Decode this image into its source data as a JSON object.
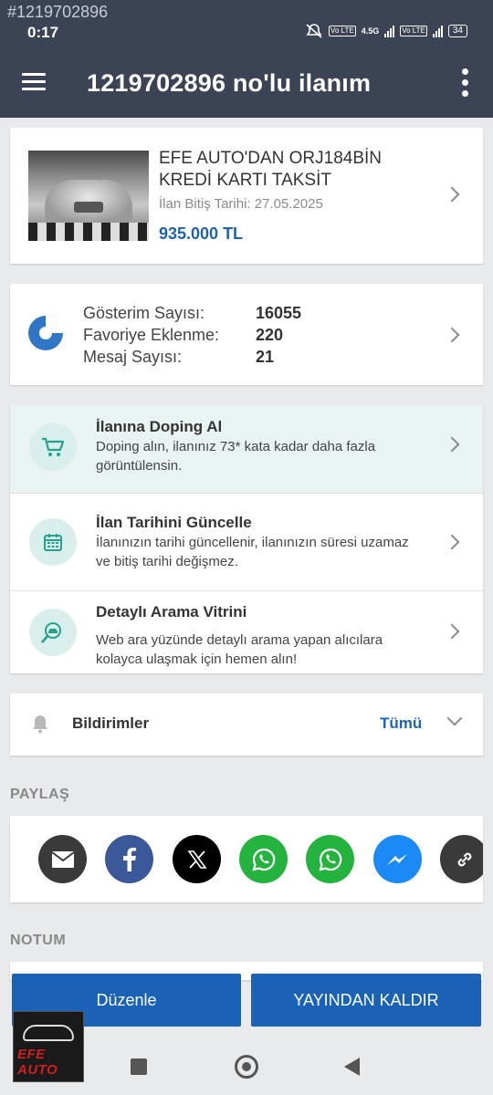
{
  "status": {
    "watermark": "#1219702896",
    "time": "0:17",
    "net_label": "4.5G",
    "lte_label": "Vo LTE",
    "battery": "34"
  },
  "appbar": {
    "title": "1219702896 no'lu ilanım"
  },
  "listing": {
    "title": "EFE AUTO'DAN ORJ184BİN KREDİ KARTI TAKSİT",
    "end_date": "İlan Bitiş Tarihi: 27.05.2025",
    "price": "935.000 TL"
  },
  "stats": [
    {
      "label": "Gösterim Sayısı:",
      "value": "16055"
    },
    {
      "label": "Favoriye Eklenme:",
      "value": "220"
    },
    {
      "label": "Mesaj Sayısı:",
      "value": "21"
    }
  ],
  "promos": [
    {
      "title": "İlanına Doping Al",
      "desc": "Doping alın, ilanınız 73* kata kadar daha fazla görüntülensin.",
      "icon": "cart-icon"
    },
    {
      "title": "İlan Tarihini Güncelle",
      "desc": "İlanınızın tarihi güncellenir, ilanınızın süresi uzamaz ve bitiş tarihi değişmez.",
      "icon": "calendar-icon"
    },
    {
      "title": "Detaylı Arama Vitrini",
      "desc": "Web ara yüzünde detaylı arama yapan alıcılara kolayca ulaşmak için hemen alın!",
      "icon": "search-car-icon"
    }
  ],
  "notifications": {
    "title": "Bildirimler",
    "all_label": "Tümü"
  },
  "share": {
    "label": "PAYLAŞ",
    "buttons": [
      {
        "name": "email-icon",
        "color": "#3a3a3a"
      },
      {
        "name": "facebook-icon",
        "color": "#3b5998"
      },
      {
        "name": "x-icon",
        "color": "#000000"
      },
      {
        "name": "whatsapp-icon",
        "color": "#25b33f"
      },
      {
        "name": "whatsapp-icon",
        "color": "#25b33f"
      },
      {
        "name": "messenger-icon",
        "color": "#1b8af5"
      },
      {
        "name": "link-icon",
        "color": "#3a3a3a"
      }
    ]
  },
  "note": {
    "label": "NOTUM"
  },
  "actions": {
    "edit": "Düzenle",
    "unpublish": "YAYINDAN KALDIR"
  },
  "logo": {
    "text": "EFE AUTO"
  }
}
